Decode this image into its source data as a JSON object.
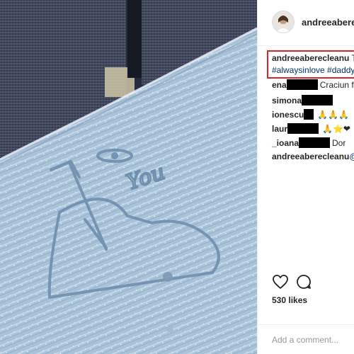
{
  "post": {
    "username": "andreeaberecleanu",
    "likes": "530 likes",
    "caption": {
      "user": "andreeaberecleanu",
      "text": " Tu",
      "hashtags": "#alwaysinlove #daddy"
    }
  },
  "comments": [
    {
      "user": "ena",
      "text": " Craciun ferici",
      "emoji": ""
    },
    {
      "user": "simona",
      "text": "",
      "emoji": ""
    },
    {
      "user": "ionescu",
      "text": "",
      "emoji": "🙏🙏🙏"
    },
    {
      "user": "laur",
      "text": "",
      "emoji": "🙏⭐❤"
    },
    {
      "user": "_ioana",
      "text": " Dor",
      "emoji": ""
    },
    {
      "user": "andreeaberecleanu",
      "text": " @_",
      "emoji": ""
    }
  ],
  "comment_input": {
    "placeholder": "Add a comment..."
  },
  "photo": {
    "drawn_text": "You"
  },
  "icons": [
    "heart-icon",
    "comment-icon"
  ],
  "colors": {
    "highlight": "#d9262c",
    "link": "#003569",
    "text": "#262626"
  }
}
